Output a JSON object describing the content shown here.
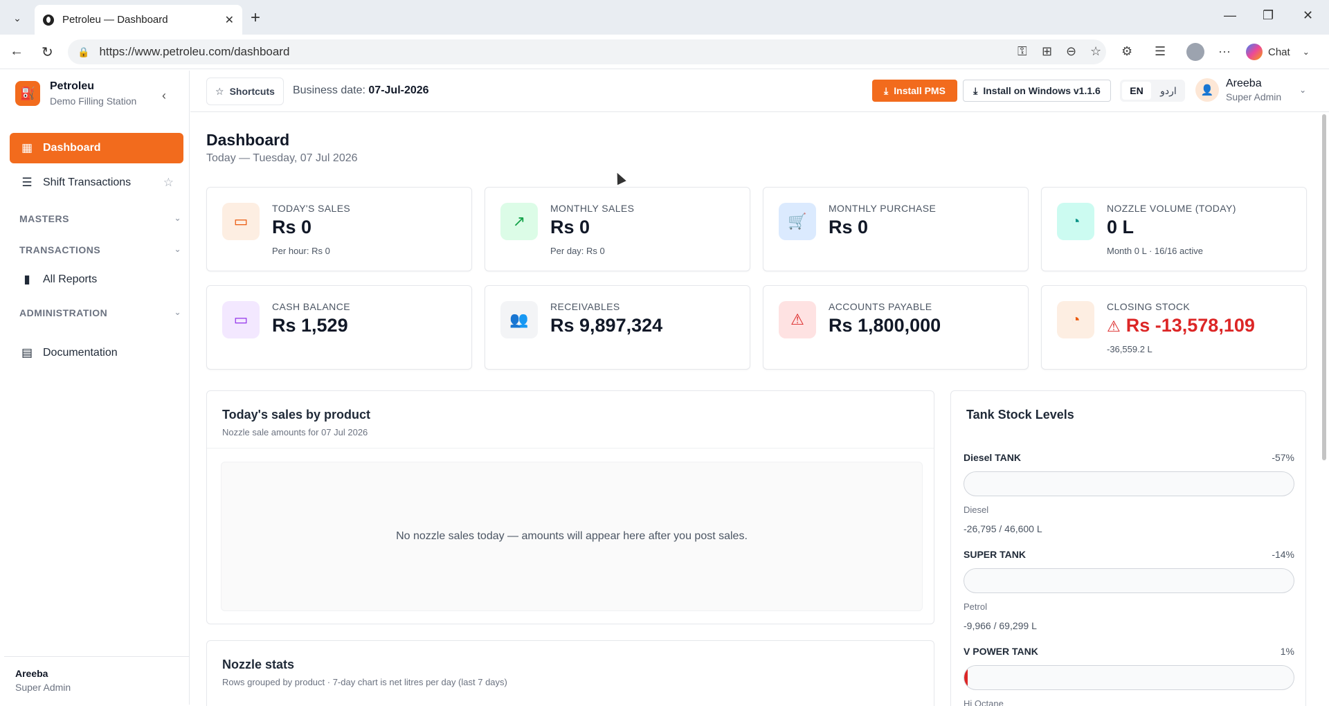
{
  "browser": {
    "tab_title": "Petroleu — Dashboard",
    "url": "https://www.petroleu.com/dashboard",
    "chat_label": "Chat"
  },
  "sidebar": {
    "brand_name": "Petroleu",
    "brand_sub": "Demo Filling Station",
    "items": [
      {
        "label": "Dashboard",
        "icon": "grid-icon",
        "active": true
      },
      {
        "label": "Shift Transactions",
        "icon": "list-icon"
      },
      {
        "label": "All Reports",
        "icon": "bar-chart-icon"
      },
      {
        "label": "Documentation",
        "icon": "book-icon"
      }
    ],
    "sections": [
      "MASTERS",
      "TRANSACTIONS",
      "ADMINISTRATION"
    ],
    "footer_name": "Areeba",
    "footer_role": "Super Admin"
  },
  "topbar": {
    "shortcuts_label": "Shortcuts",
    "business_date_label": "Business date:",
    "business_date": "07-Jul-2026",
    "install_pms": "Install PMS",
    "install_windows": "Install on Windows v1.1.6",
    "lang_en": "EN",
    "lang_ur": "اردو",
    "user_name": "Areeba",
    "user_role": "Super Admin"
  },
  "page": {
    "title": "Dashboard",
    "subtitle": "Today — Tuesday, 07 Jul 2026"
  },
  "cards": [
    {
      "label": "TODAY'S SALES",
      "value": "Rs 0",
      "sub": "Per hour: Rs 0",
      "icon": "cash-icon",
      "bg": "#fdeee2",
      "fg": "#ea580c"
    },
    {
      "label": "MONTHLY SALES",
      "value": "Rs 0",
      "sub": "Per day: Rs 0",
      "icon": "trend-up-icon",
      "bg": "#dcfce7",
      "fg": "#16a34a"
    },
    {
      "label": "MONTHLY PURCHASE",
      "value": "Rs 0",
      "sub": "",
      "icon": "cart-icon",
      "bg": "#dbeafe",
      "fg": "#2563eb"
    },
    {
      "label": "NOZZLE VOLUME (TODAY)",
      "value": "0 L",
      "sub": "Month 0 L · 16/16 active",
      "icon": "gauge-icon",
      "bg": "#ccfbf1",
      "fg": "#0d9488"
    },
    {
      "label": "CASH BALANCE",
      "value": "Rs 1,529",
      "sub": "",
      "icon": "cash-icon",
      "bg": "#f3e8ff",
      "fg": "#9333ea"
    },
    {
      "label": "RECEIVABLES",
      "value": "Rs 9,897,324",
      "sub": "",
      "icon": "users-icon",
      "bg": "#f3f4f6",
      "fg": "#4b5563"
    },
    {
      "label": "ACCOUNTS PAYABLE",
      "value": "Rs 1,800,000",
      "sub": "",
      "icon": "warning-icon",
      "bg": "#fee2e2",
      "fg": "#dc2626"
    },
    {
      "label": "CLOSING STOCK",
      "value": "Rs -13,578,109",
      "sub": "-36,559.2 L",
      "icon": "gauge-icon",
      "bg": "#fdeee2",
      "fg": "#ea580c"
    }
  ],
  "sales_panel": {
    "title": "Today's sales by product",
    "subtitle": "Nozzle sale amounts for 07 Jul 2026",
    "empty": "No nozzle sales today — amounts will appear here after you post sales."
  },
  "nozzle_panel": {
    "title": "Nozzle stats",
    "subtitle": "Rows grouped by product · 7-day chart is net litres per day (last 7 days)"
  },
  "tank_panel": {
    "title": "Tank Stock Levels",
    "tanks": [
      {
        "name": "Diesel TANK",
        "pct": "-57%",
        "level": 0,
        "product": "Diesel",
        "qty": "-26,795 / 46,600 L"
      },
      {
        "name": "SUPER TANK",
        "pct": "-14%",
        "level": 0,
        "product": "Petrol",
        "qty": "-9,966 / 69,299 L"
      },
      {
        "name": "V POWER TANK",
        "pct": "1%",
        "level": 0.01,
        "product": "Hi Octane",
        "qty": ""
      }
    ]
  }
}
